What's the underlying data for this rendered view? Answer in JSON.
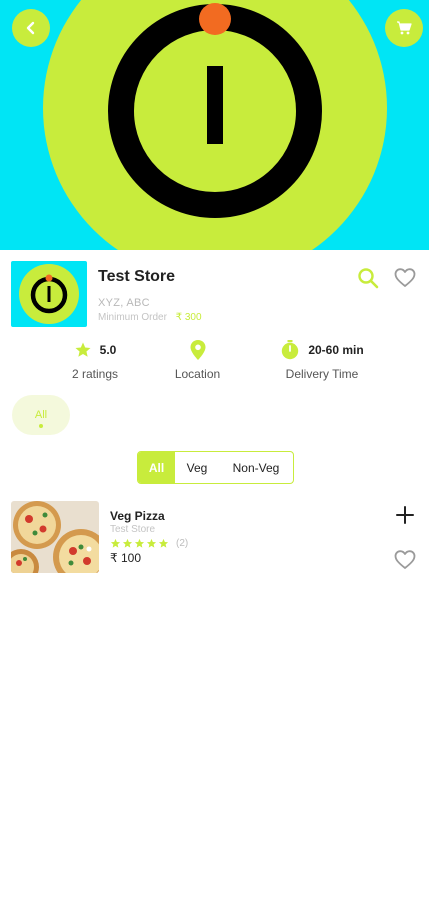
{
  "colors": {
    "accent": "#c8ec3c",
    "hero_bg": "#00e5f5",
    "logo_dot": "#f26b21"
  },
  "header": {
    "back_icon": "arrow-left-icon",
    "cart_icon": "cart-icon"
  },
  "store": {
    "name": "Test Store",
    "address": "XYZ, ABC",
    "min_order_label": "Minimum Order",
    "min_order_value": "₹ 300"
  },
  "stats": {
    "rating_value": "5.0",
    "rating_label": "2 ratings",
    "location_label": "Location",
    "time_value": "20-60 min",
    "time_label": "Delivery Time"
  },
  "categories": [
    {
      "label": "All",
      "selected": true
    }
  ],
  "filters": {
    "all": "All",
    "veg": "Veg",
    "nonveg": "Non-Veg",
    "selected": "All"
  },
  "products": [
    {
      "name": "Veg Pizza",
      "store": "Test Store",
      "rating": 5,
      "rating_count": "(2)",
      "price": "₹ 100"
    }
  ]
}
